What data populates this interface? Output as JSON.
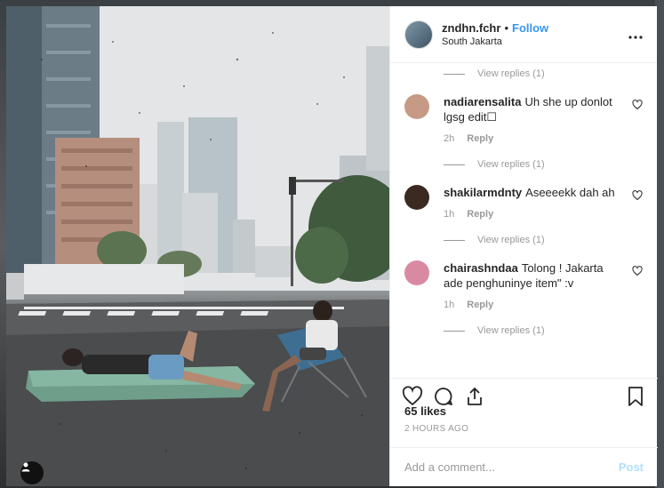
{
  "post": {
    "username": "zndhn.fchr",
    "separator": "•",
    "follow_label": "Follow",
    "location": "South Jakarta",
    "more_icon": "more-dots-icon"
  },
  "comments_section": {
    "view_replies_label": "View replies (1)",
    "comments": [
      {
        "username": "nadiarensalita",
        "text": "Uh she up donlot lgsg edit☐",
        "age": "2h",
        "reply_label": "Reply",
        "view_replies": "View replies (1)",
        "avatar_color": "#c79a86"
      },
      {
        "username": "shakilarmdnty",
        "text": "Aseeeekk dah ah",
        "age": "1h",
        "reply_label": "Reply",
        "view_replies": "View replies (1)",
        "avatar_color": "#3b2a22"
      },
      {
        "username": "chairashndaa",
        "text": "Tolong ! Jakarta ade penghuninye item\" :v",
        "age": "1h",
        "reply_label": "Reply",
        "view_replies": "View replies (1)",
        "avatar_color": "#d98aa2"
      }
    ]
  },
  "engagement": {
    "likes": "65 likes",
    "time_ago": "2 HOURS AGO"
  },
  "composer": {
    "placeholder": "Add a comment...",
    "post_label": "Post"
  },
  "colors": {
    "accent": "#3897f0",
    "post_disabled": "#b2dffc",
    "muted": "#999999",
    "text": "#262626"
  }
}
